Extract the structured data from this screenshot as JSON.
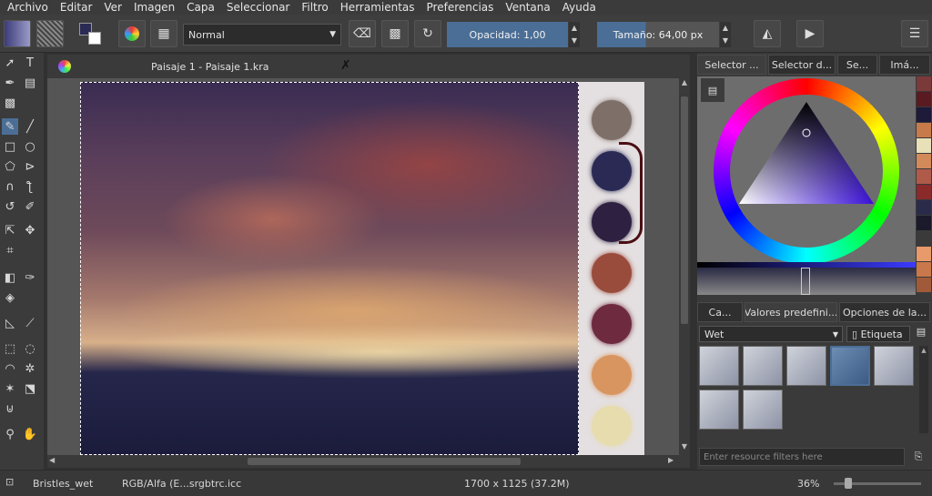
{
  "menu": [
    "Archivo",
    "Editar",
    "Ver",
    "Imagen",
    "Capa",
    "Seleccionar",
    "Filtro",
    "Herramientas",
    "Preferencias",
    "Ventana",
    "Ayuda"
  ],
  "toolbar": {
    "blend_mode": "Normal",
    "opacity_label": "Opacidad:",
    "opacity_value": "1,00",
    "size_label": "Tamaño:",
    "size_value": "64,00 px"
  },
  "document": {
    "tab_title": "Paisaje 1 - Paisaje 1.kra"
  },
  "right_panel": {
    "top_tabs": [
      "Selector ...",
      "Selector d...",
      "Se...",
      "Imá..."
    ],
    "bottom_tabs": [
      "Ca...",
      "Valores predefini...",
      "Opciones de la..."
    ],
    "preset_filter": "Wet",
    "tag_button": "Etiqueta",
    "search_placeholder": "Enter resource filters here"
  },
  "status": {
    "brush": "Bristles_wet",
    "color_profile": "RGB/Alfa (E...srgbtrc.icc",
    "image_size": "1700 x 1125 (37.2M)",
    "zoom": "36%"
  },
  "colors": {
    "accent": "#4b6e96",
    "palette_swatches": [
      "#7a3a3a",
      "#5a1a22",
      "#1e1a3a",
      "#c77a4a",
      "#e8e0b8",
      "#d28a5a",
      "#b05a4a",
      "#8a2a2a",
      "#2a2a4a",
      "#1a1a2a",
      "#3a3a3a",
      "#e89a6a",
      "#c8784a",
      "#a05a3a"
    ]
  },
  "canvas_dabs": [
    {
      "color": "#7e7068"
    },
    {
      "color": "#2a2a55"
    },
    {
      "color": "#2e2040"
    },
    {
      "color": "#9a4c3c"
    },
    {
      "color": "#6e2a3e"
    },
    {
      "color": "#d99560"
    },
    {
      "color": "#e6dcae"
    }
  ]
}
